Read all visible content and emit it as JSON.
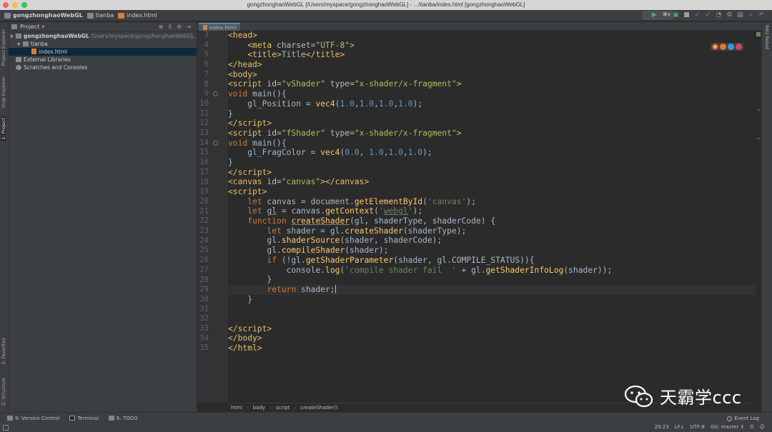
{
  "window": {
    "title": "gongzhonghaoWebGL [/Users/myspace/gongzhonghaoWebGL] - .../tianba/index.html [gongzhonghaoWebGL]"
  },
  "navbar": {
    "crumbs": [
      "gongzhonghaoWebGL",
      "tianba",
      "index.html"
    ]
  },
  "left_stripe": {
    "tabs": [
      "1: Project",
      "Gulp Explorer",
      "Project Explorer",
      "2: Favorites",
      "Z: Structure"
    ]
  },
  "project": {
    "header": "Project",
    "tree": [
      {
        "label": "gongzhonghaoWebGL",
        "path": "/Users/myspace/gongzhonghaoWebGL",
        "type": "folder",
        "level": 0,
        "expanded": true
      },
      {
        "label": "tianba",
        "path": "",
        "type": "folder",
        "level": 1,
        "expanded": true
      },
      {
        "label": "index.html",
        "path": "",
        "type": "html",
        "level": 2,
        "selected": true
      },
      {
        "label": "External Libraries",
        "path": "",
        "type": "lib",
        "level": 0
      },
      {
        "label": "Scratches and Consoles",
        "path": "",
        "type": "scratch",
        "level": 0
      }
    ]
  },
  "editor": {
    "tab_label": "index.html",
    "breadcrumb": [
      "html",
      "body",
      "script",
      "createShader()"
    ],
    "current_line": 29,
    "lines": [
      {
        "n": "3",
        "html": "<span class='tag'>&lt;head&gt;</span>"
      },
      {
        "n": "4",
        "html": "    <span class='tag'>&lt;meta </span><span class='attr'>charset=</span><span class='str'>\"UTF-8\"</span><span class='tag'>&gt;</span>"
      },
      {
        "n": "5",
        "html": "    <span class='tag'>&lt;title&gt;</span><span class='plain'>Title</span><span class='tag'>&lt;/title&gt;</span>"
      },
      {
        "n": "6",
        "html": "<span class='tag'>&lt;/head&gt;</span>"
      },
      {
        "n": "7",
        "html": "<span class='tag'>&lt;body&gt;</span>"
      },
      {
        "n": "8",
        "html": "<span class='tag'>&lt;script </span><span class='attr'>id=</span><span class='str'>\"vShader\"</span> <span class='attr'>type=</span><span class='str'>\"x-shader/x-fragment\"</span><span class='tag'>&gt;</span>"
      },
      {
        "n": "9",
        "html": "<span class='kw'>void</span> main(){",
        "mark": true
      },
      {
        "n": "10",
        "html": "    gl_Position = <span class='fn'>vec4</span>(<span class='num'>1.0</span>,<span class='num'>1.0</span>,<span class='num'>1.0</span>,<span class='num'>1.0</span>);"
      },
      {
        "n": "11",
        "html": "}"
      },
      {
        "n": "12",
        "html": "<span class='tag'>&lt;/script&gt;</span>"
      },
      {
        "n": "13",
        "html": "<span class='tag'>&lt;script </span><span class='attr'>id=</span><span class='str'>\"fShader\"</span> <span class='attr'>type=</span><span class='str'>\"x-shader/x-fragment\"</span><span class='tag'>&gt;</span>"
      },
      {
        "n": "14",
        "html": "<span class='kw'>void</span> main(){",
        "mark": true
      },
      {
        "n": "15",
        "html": "    gl_FragColor = <span class='fn'>vec4</span>(<span class='num'>0.0</span>, <span class='num'>1.0</span>,<span class='num'>1.0</span>,<span class='num'>1.0</span>);"
      },
      {
        "n": "16",
        "html": "}"
      },
      {
        "n": "17",
        "html": "<span class='tag'>&lt;/script&gt;</span>"
      },
      {
        "n": "18",
        "html": "<span class='tag'>&lt;canvas </span><span class='attr'>id=</span><span class='str'>\"canvas\"</span><span class='tag'>&gt;&lt;/canvas&gt;</span>"
      },
      {
        "n": "19",
        "html": "<span class='tag'>&lt;script&gt;</span>"
      },
      {
        "n": "20",
        "html": "    <span class='kw'>let</span> canvas = document.<span class='fn'>getElementById</span>(<span class='jsstr'>'canvas'</span>);"
      },
      {
        "n": "21",
        "html": "    <span class='kw'>let</span> <span class='uline'>gl</span> = canvas.<span class='fn'>getContext</span>(<span class='jsstr'>'<span class=\"uline\">webgl</span>'</span>);"
      },
      {
        "n": "22",
        "html": "    <span class='kw'>function</span> <span class='fn uline'>createShader</span>(gl, shaderType, shaderCode) {"
      },
      {
        "n": "23",
        "html": "        <span class='kw'>let</span> shader = gl.<span class='fn'>createShader</span>(shaderType);"
      },
      {
        "n": "24",
        "html": "        gl.<span class='fn'>shaderSource</span>(shader, shaderCode);"
      },
      {
        "n": "25",
        "html": "        gl.<span class='fn'>compileShader</span>(shader);"
      },
      {
        "n": "26",
        "html": "        <span class='kw'>if</span> (!gl.<span class='fn'>getShaderParameter</span>(shader, gl.COMPILE_STATUS)){"
      },
      {
        "n": "27",
        "html": "            console.<span class='fn'>log</span>(<span class='jsstr'>'compile shader fail  '</span> + gl.<span class='fn'>getShaderInfoLog</span>(shader));"
      },
      {
        "n": "28",
        "html": "        }"
      },
      {
        "n": "29",
        "html": "        <span class='kw'>return</span> shader;<span class='caret'></span>"
      },
      {
        "n": "30",
        "html": "    }"
      },
      {
        "n": "31",
        "html": ""
      },
      {
        "n": "32",
        "html": ""
      },
      {
        "n": "33",
        "html": "<span class='tag'>&lt;/script&gt;</span>"
      },
      {
        "n": "34",
        "html": "<span class='tag'>&lt;/body&gt;</span>"
      },
      {
        "n": "35",
        "html": "<span class='tag'>&lt;/html&gt;</span>"
      }
    ]
  },
  "right_stripe": {
    "tab": "RAU Robot"
  },
  "toolwindows": {
    "items": [
      "9: Version Control",
      "Terminal",
      "6: TODO"
    ],
    "event_log": "Event Log"
  },
  "statusbar": {
    "position": "29:23",
    "line_sep": "LF↓",
    "encoding": "UTF-8",
    "git": "Git: master ↕"
  },
  "watermark": {
    "text": "天霸学ccc"
  },
  "colors": {
    "accent": "#4a88c7",
    "keyword": "#cc7832",
    "tag": "#e8bf6a",
    "string": "#a5c25c",
    "number": "#6897bb",
    "function": "#ffc66d"
  }
}
